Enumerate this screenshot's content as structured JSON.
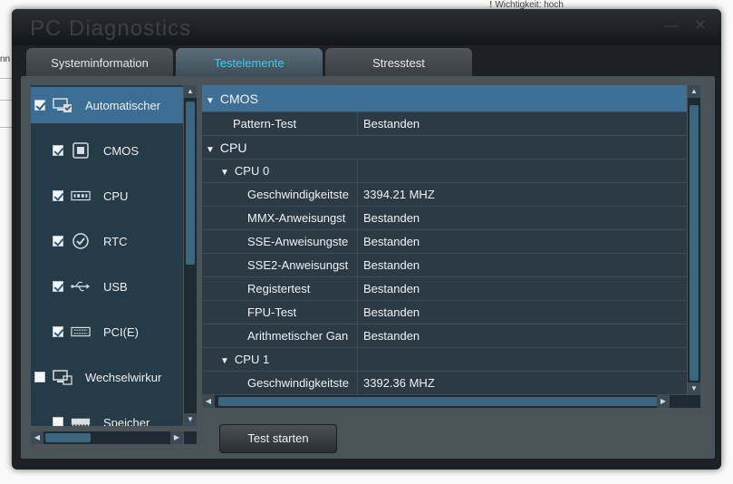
{
  "background": {
    "top_strip": "Wichtigkeit: hoch",
    "left_fragment": "nn"
  },
  "window": {
    "title": "PC Diagnostics"
  },
  "tabs": [
    {
      "label": "Systeminformation",
      "active": false
    },
    {
      "label": "Testelemente",
      "active": true
    },
    {
      "label": "Stresstest",
      "active": false
    }
  ],
  "left_panel": {
    "items": [
      {
        "label": "Automatischer",
        "checked": true,
        "icon": "monitor-check-icon",
        "level": 0,
        "selected": true
      },
      {
        "label": "CMOS",
        "checked": true,
        "icon": "chip-icon",
        "level": 1
      },
      {
        "label": "CPU",
        "checked": true,
        "icon": "cpu-icon",
        "level": 1
      },
      {
        "label": "RTC",
        "checked": true,
        "icon": "clock-check-icon",
        "level": 1
      },
      {
        "label": "USB",
        "checked": true,
        "icon": "usb-icon",
        "level": 1
      },
      {
        "label": "PCI(E)",
        "checked": true,
        "icon": "pci-card-icon",
        "level": 1
      },
      {
        "label": "Wechselwirkur",
        "checked": false,
        "icon": "monitor-icon",
        "level": 0
      },
      {
        "label": "Speicher",
        "checked": false,
        "icon": "memory-icon",
        "level": 1
      }
    ]
  },
  "results": {
    "rows": [
      {
        "type": "header",
        "name": "CMOS",
        "value": ""
      },
      {
        "type": "item",
        "name": "Pattern-Test",
        "value": "Bestanden",
        "indent": 1
      },
      {
        "type": "group",
        "name": "CPU",
        "value": ""
      },
      {
        "type": "subgroup",
        "name": "CPU 0",
        "value": ""
      },
      {
        "type": "item",
        "name": "Geschwindigkeitste",
        "value": "3394.21 MHZ",
        "indent": 2
      },
      {
        "type": "item",
        "name": "MMX-Anweisungst",
        "value": "Bestanden",
        "indent": 2
      },
      {
        "type": "item",
        "name": "SSE-Anweisungste",
        "value": "Bestanden",
        "indent": 2
      },
      {
        "type": "item",
        "name": "SSE2-Anweisungst",
        "value": "Bestanden",
        "indent": 2
      },
      {
        "type": "item",
        "name": "Registertest",
        "value": "Bestanden",
        "indent": 2
      },
      {
        "type": "item",
        "name": "FPU-Test",
        "value": "Bestanden",
        "indent": 2
      },
      {
        "type": "item",
        "name": "Arithmetischer Gan",
        "value": "Bestanden",
        "indent": 2
      },
      {
        "type": "subgroup",
        "name": "CPU 1",
        "value": ""
      },
      {
        "type": "item",
        "name": "Geschwindigkeitste",
        "value": "3392.36 MHZ",
        "indent": 2
      }
    ]
  },
  "start_button": {
    "label": "Test starten"
  },
  "colors": {
    "accent": "#3fc8f0",
    "selected_row": "#3f6f94",
    "panel_bg": "#2b3a44"
  }
}
